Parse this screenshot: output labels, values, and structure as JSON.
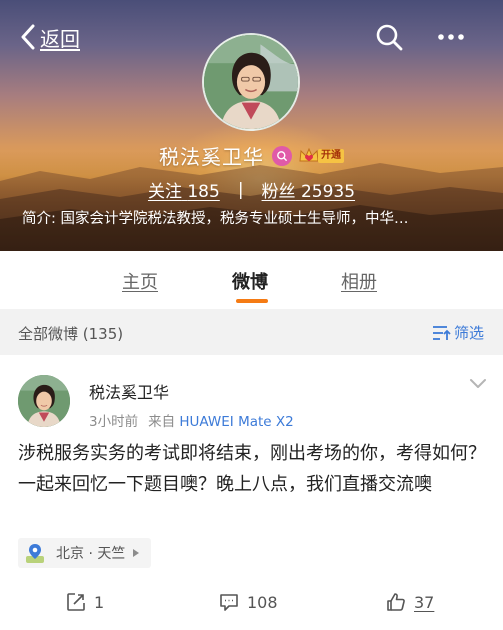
{
  "header": {
    "back_label": "返回",
    "search_icon": "search-icon",
    "more_icon": "more-icon"
  },
  "profile": {
    "name": "税法奚卫华",
    "vip_label": "开通",
    "following_label": "关注",
    "following_count": "185",
    "separator": "|",
    "followers_label": "粉丝",
    "followers_count": "25935",
    "bio": "简介: 国家会计学院税法教授，税务专业硕士生导师，中华…"
  },
  "tabs": [
    {
      "label": "主页"
    },
    {
      "label": "微博",
      "active": true
    },
    {
      "label": "相册"
    }
  ],
  "filter": {
    "count_label": "全部微博 (135)",
    "filter_label": "筛选"
  },
  "post": {
    "author": "税法奚卫华",
    "time": "3小时前",
    "source_prefix": "来自",
    "device": "HUAWEI Mate X2",
    "content": "涉税服务实务的考试即将结束，刚出考场的你，考得如何？一起来回忆一下题目噢？晚上八点，我们直播交流噢",
    "location": "北京 · 天竺",
    "reposts": "1",
    "comments": "108",
    "likes": "37"
  },
  "colors": {
    "accent_orange": "#f57b14",
    "link_blue": "#3d7bd8",
    "filter_bg": "#f2f2f2"
  }
}
